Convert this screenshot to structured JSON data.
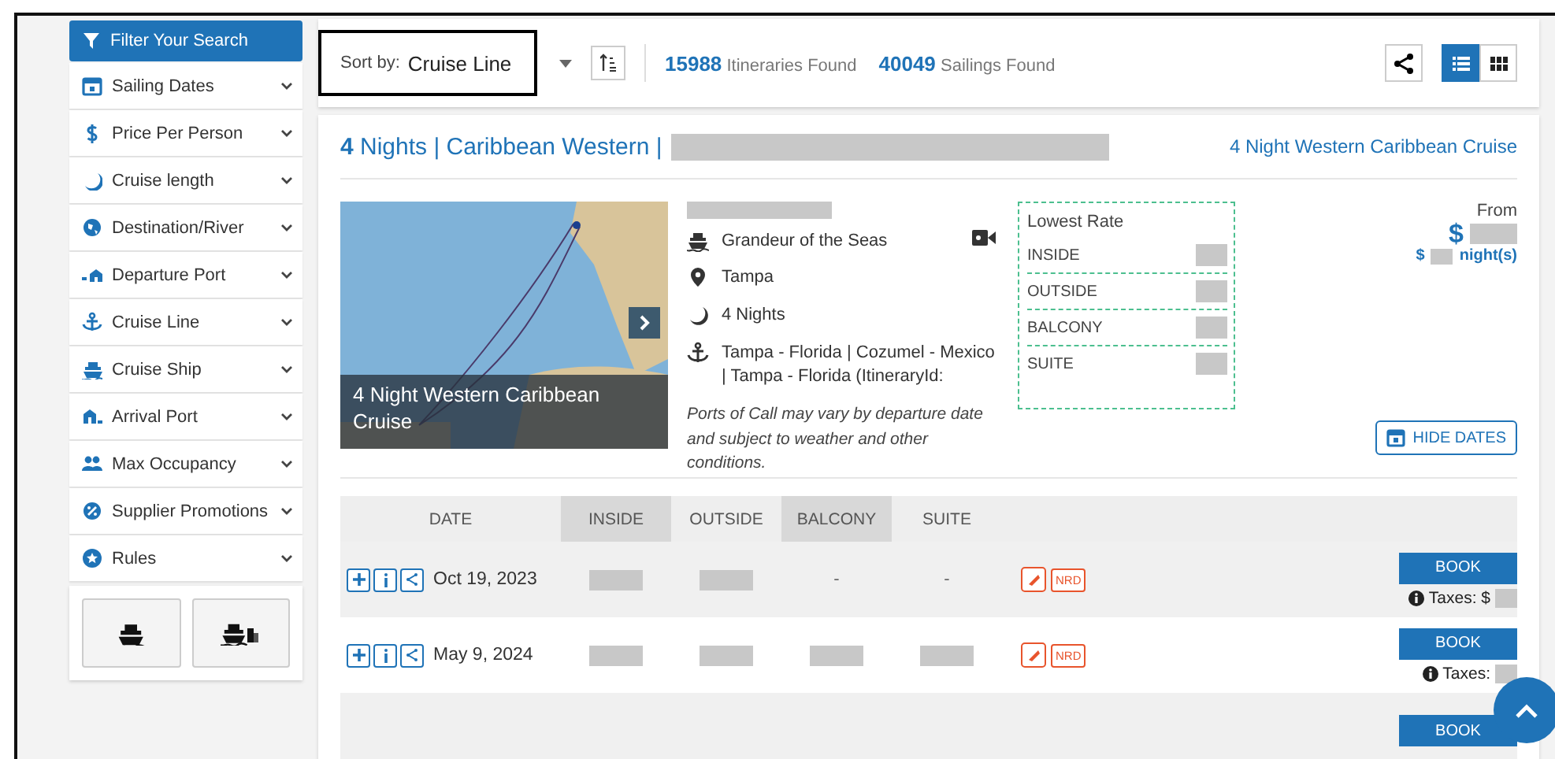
{
  "sidebar": {
    "heading": "Filter Your Search",
    "items": [
      {
        "label": "Sailing Dates",
        "expanded": false
      },
      {
        "label": "Price Per Person",
        "expanded": false
      },
      {
        "label": "Cruise length",
        "expanded": false
      },
      {
        "label": "Destination/River",
        "expanded": false
      },
      {
        "label": "Departure Port",
        "expanded": false
      },
      {
        "label": "Cruise Line",
        "expanded": false
      },
      {
        "label": "Cruise Ship",
        "expanded": false
      },
      {
        "label": "Arrival Port",
        "expanded": false
      },
      {
        "label": "Max Occupancy",
        "expanded": false
      },
      {
        "label": "Supplier Promotions",
        "expanded": false
      },
      {
        "label": "Rules",
        "expanded": false
      }
    ]
  },
  "toolbar": {
    "sort_label": "Sort by:",
    "sort_value": "Cruise Line",
    "itineraries_count": "15988",
    "itineraries_label": "Itineraries Found",
    "sailings_count": "40049",
    "sailings_label": "Sailings Found",
    "views": [
      {
        "kind": "list",
        "selected": true
      },
      {
        "kind": "grid",
        "selected": false
      }
    ]
  },
  "result": {
    "title": "**4** Nights | Caribbean Western |",
    "title_link": "4 Night Western Caribbean Cruise",
    "image_caption": "4 Night Western Caribbean Cruise",
    "ship": "Grandeur of the Seas",
    "port": "Tampa",
    "nights": "4 Nights",
    "itinerary": "Tampa - Florida | Cozumel - Mexico | Tampa - Florida (ItineraryId:",
    "note": "Ports of Call may vary by departure date and subject to weather and other conditions.",
    "lowest_rate": {
      "title": "Lowest Rate",
      "rates": [
        "INSIDE",
        "OUTSIDE",
        "BALCONY",
        "SUITE"
      ]
    },
    "from_label": "From",
    "price_currency": "$",
    "per_night_currency": "$",
    "per_night_label": "night(s)",
    "hide_dates_button": "HIDE DATES"
  },
  "sailings": {
    "columns": [
      "DATE",
      "INSIDE",
      "OUTSIDE",
      "BALCONY",
      "SUITE"
    ],
    "rows": [
      {
        "date": "Oct 19, 2023",
        "cells": [
          {
            "kind": "redacted"
          },
          {
            "kind": "redacted"
          },
          {
            "kind": "text",
            "text": "-"
          },
          {
            "kind": "text",
            "text": "-"
          }
        ],
        "badge": "NRD",
        "book": "BOOK",
        "taxes": "Taxes: $"
      },
      {
        "date": "May 9, 2024",
        "cells": [
          {
            "kind": "redacted"
          },
          {
            "kind": "redacted"
          },
          {
            "kind": "redacted"
          },
          {
            "kind": "redacted"
          }
        ],
        "badge": "NRD",
        "book": "BOOK",
        "taxes": "Taxes:"
      },
      {
        "book": "BOOK"
      }
    ]
  }
}
